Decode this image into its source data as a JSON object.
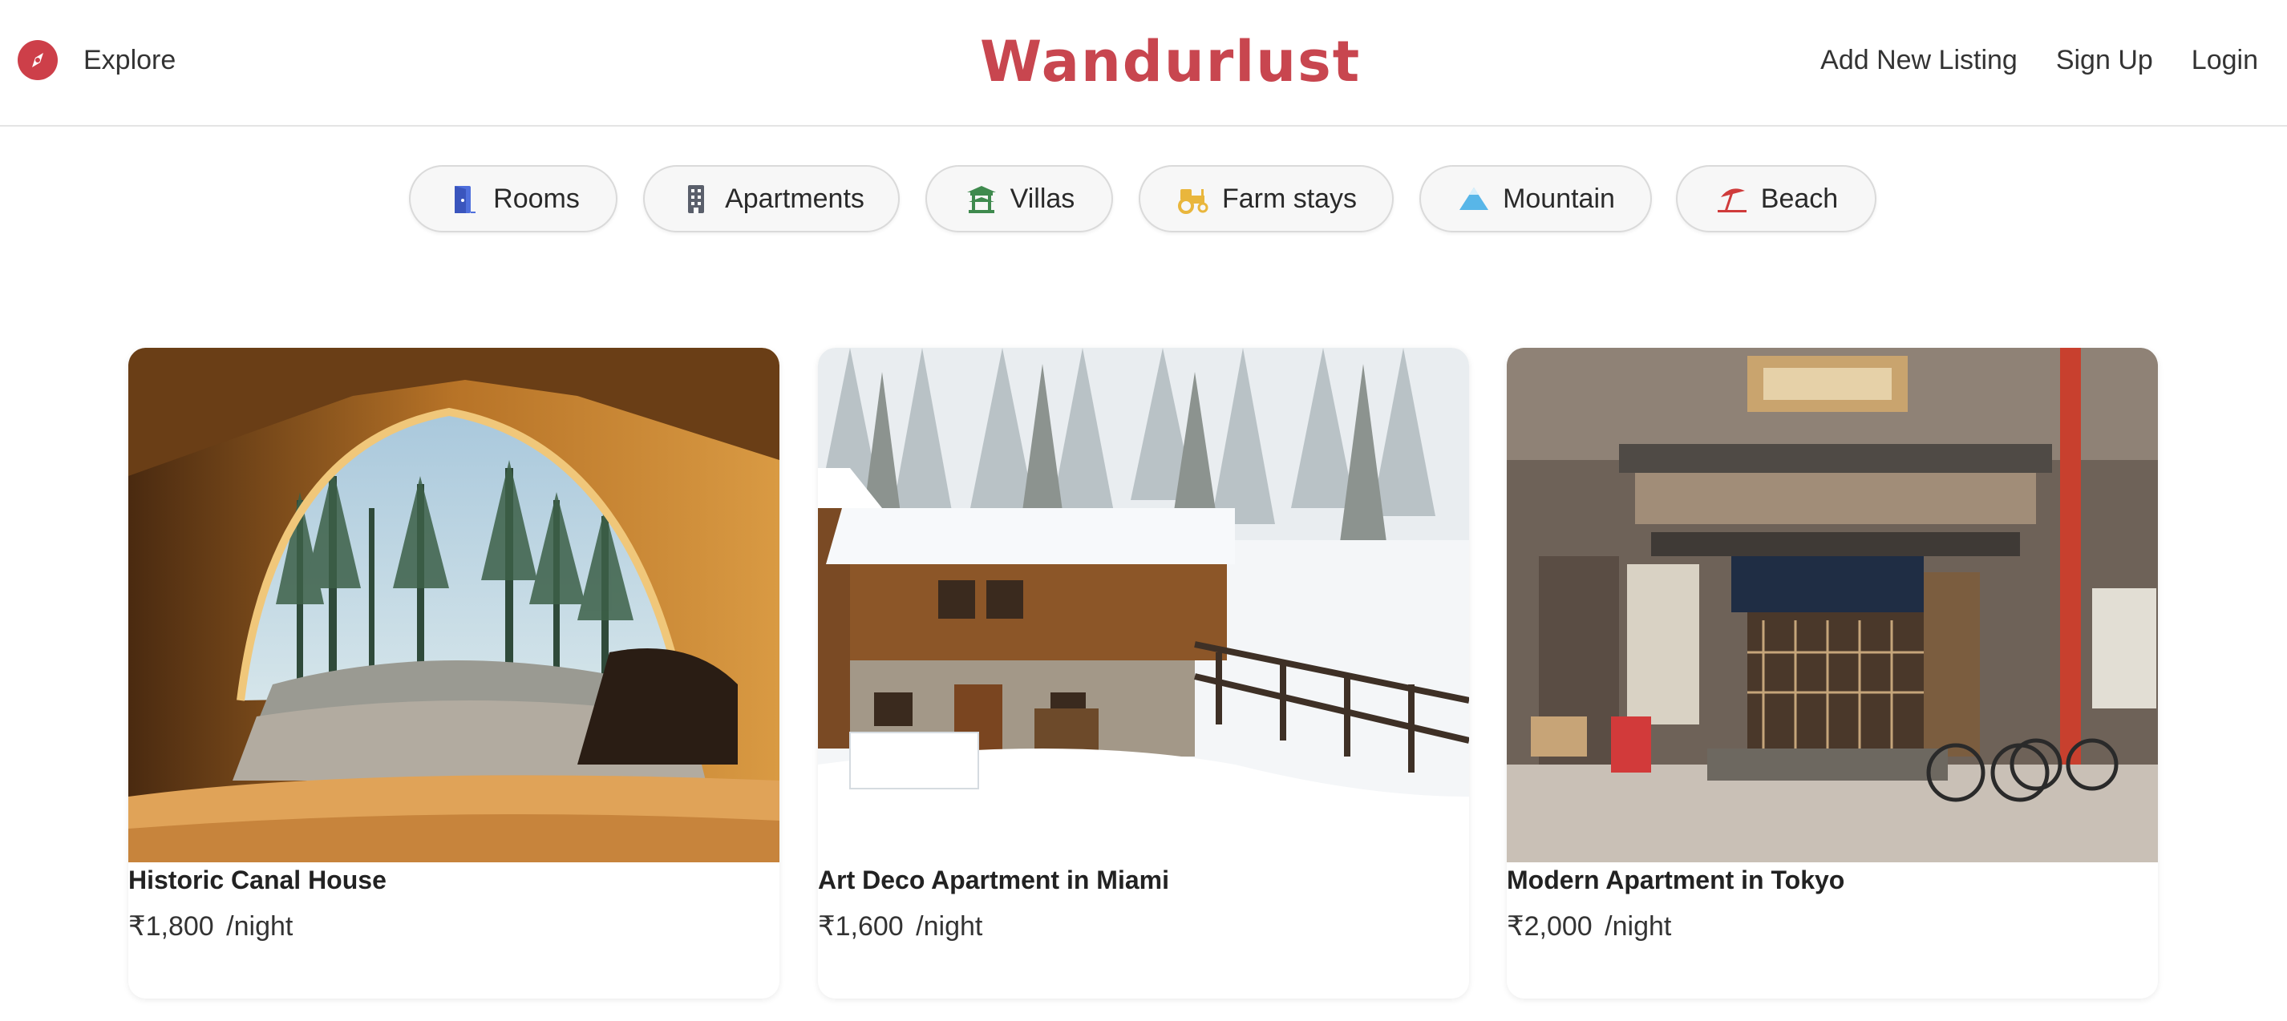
{
  "nav": {
    "explore_label": "Explore",
    "brand": "Wandurlust",
    "add_listing_label": "Add New Listing",
    "signup_label": "Sign Up",
    "login_label": "Login"
  },
  "filters": [
    {
      "label": "Rooms",
      "icon": "door-open-icon",
      "color": "#4f6fdc"
    },
    {
      "label": "Apartments",
      "icon": "building-icon",
      "color": "#5a5f6b"
    },
    {
      "label": "Villas",
      "icon": "pagoda-icon",
      "color": "#3f8a4e"
    },
    {
      "label": "Farm stays",
      "icon": "tractor-icon",
      "color": "#e9b63c"
    },
    {
      "label": "Mountain",
      "icon": "mountain-icon",
      "color": "#58b6e8"
    },
    {
      "label": "Beach",
      "icon": "umbrella-beach-icon",
      "color": "#cf3b3b"
    }
  ],
  "listings": [
    {
      "title": "Historic Canal House",
      "price": "₹1,800",
      "per": "/night",
      "image": "tent-forest-view"
    },
    {
      "title": "Art Deco Apartment in Miami",
      "price": "₹1,600",
      "per": "/night",
      "image": "snowy-chalet"
    },
    {
      "title": "Modern Apartment in Tokyo",
      "price": "₹2,000",
      "per": "/night",
      "image": "tokyo-shopfront"
    }
  ],
  "colors": {
    "brand": "#c8464f",
    "accent": "#cd3f49"
  }
}
